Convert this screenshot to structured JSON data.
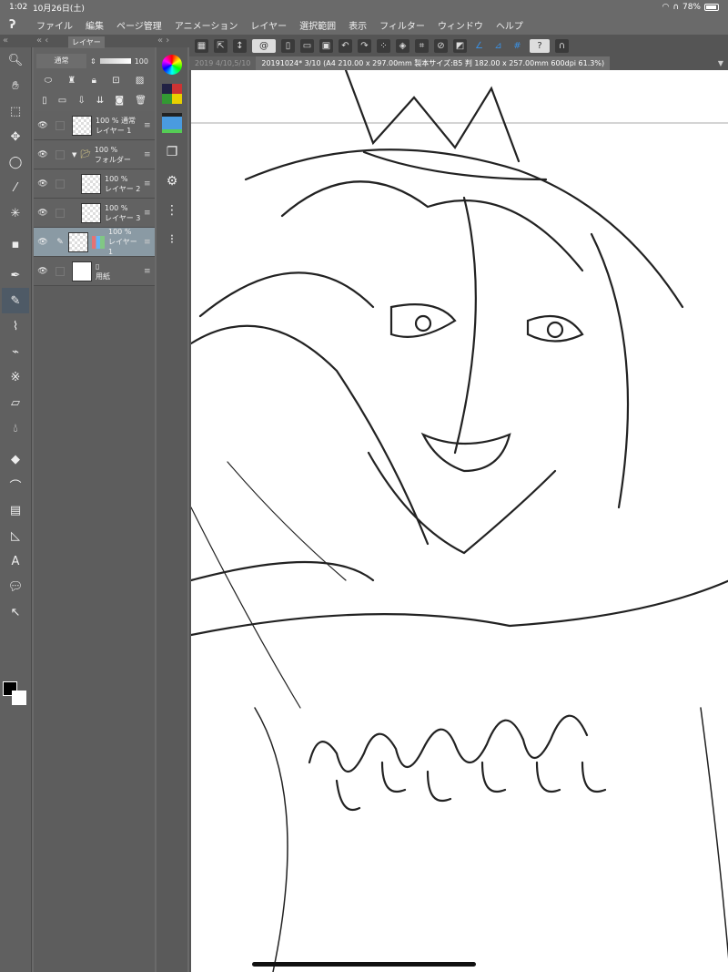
{
  "status": {
    "time": "1:02",
    "date": "10月26日(土)",
    "battery": "78%",
    "battery_level": 0.78
  },
  "menu": [
    "ファイル",
    "編集",
    "ページ管理",
    "アニメーション",
    "レイヤー",
    "選択範囲",
    "表示",
    "フィルター",
    "ウィンドウ",
    "ヘルプ"
  ],
  "panel_tab": "レイヤー",
  "layer_panel": {
    "blend_mode": "通常",
    "opacity": "100"
  },
  "layers": [
    {
      "percent": "100 %",
      "mode": "通常",
      "name": "レイヤー 1",
      "kind": "raster"
    },
    {
      "percent": "100 %",
      "mode": "",
      "name": "フォルダー",
      "kind": "folder"
    },
    {
      "percent": "100 %",
      "mode": "",
      "name": "レイヤー 2",
      "kind": "raster"
    },
    {
      "percent": "100 %",
      "mode": "",
      "name": "レイヤー 3",
      "kind": "raster"
    },
    {
      "percent": "100 %",
      "mode": "",
      "name": "レイヤー 1",
      "kind": "selected"
    },
    {
      "percent": "",
      "mode": "",
      "name": "用紙",
      "kind": "paper"
    }
  ],
  "doc_tabs": [
    {
      "label": "2019 4/10,5/10",
      "active": false
    },
    {
      "label": "20191024* 3/10 (A4 210.00 x 297.00mm 製本サイズ:B5 判 182.00 x 257.00mm 600dpi 61.3%)",
      "active": true
    }
  ]
}
